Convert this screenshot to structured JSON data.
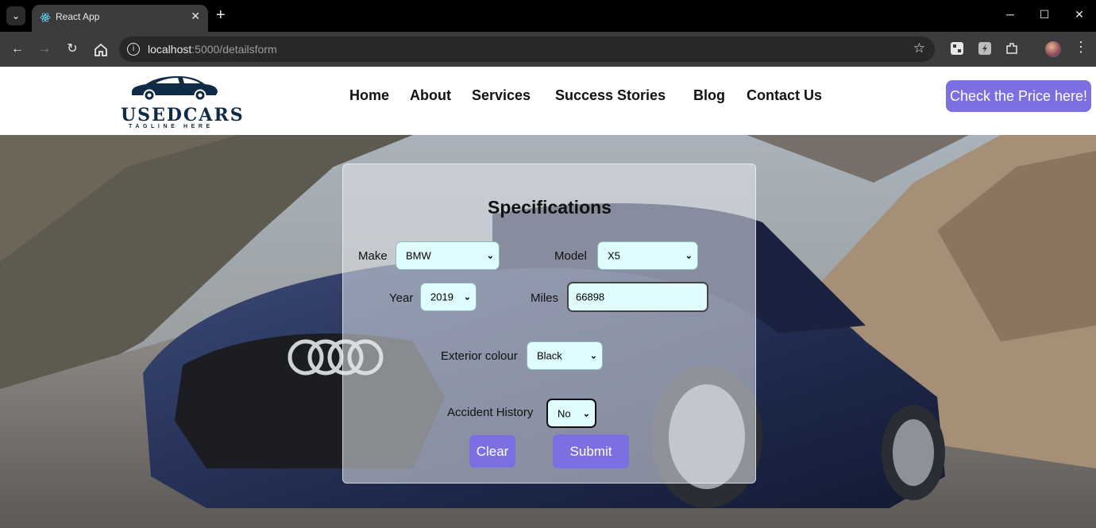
{
  "browser": {
    "tab_title": "React App",
    "tab_close": "✕",
    "new_tab": "+",
    "url_host": "localhost",
    "url_path": ":5000/detailsform",
    "window_controls": {
      "minimize": "─",
      "maximize": "☐",
      "close": "✕"
    },
    "icons": [
      "tab-search-icon",
      "react-icon",
      "back-icon",
      "forward-icon",
      "reload-icon",
      "home-icon",
      "site-info-icon",
      "bookmark-star-icon",
      "extension-icon",
      "profile-avatar",
      "menu-icon"
    ]
  },
  "header": {
    "logo_text": "USEDCARS",
    "logo_tagline": "TAGLINE HERE",
    "nav": [
      {
        "label": "Home"
      },
      {
        "label": "About"
      },
      {
        "label": "Services"
      },
      {
        "label": "Success Stories"
      },
      {
        "label": "Blog"
      },
      {
        "label": "Contact Us"
      }
    ],
    "cta_label": "Check the Price here!"
  },
  "form": {
    "title": "Specifications",
    "make_label": "Make",
    "make_value": "BMW",
    "model_label": "Model",
    "model_value": "X5",
    "year_label": "Year",
    "year_value": "2019",
    "miles_label": "Miles",
    "miles_value": "66898",
    "colour_label": "Exterior colour",
    "colour_value": "Black",
    "accident_label": "Accident History",
    "accident_value": "No",
    "clear_label": "Clear",
    "submit_label": "Submit"
  },
  "colors": {
    "accent": "#7b6fe2",
    "field_bg": "#dffcff",
    "logo_navy": "#0f2b45"
  }
}
